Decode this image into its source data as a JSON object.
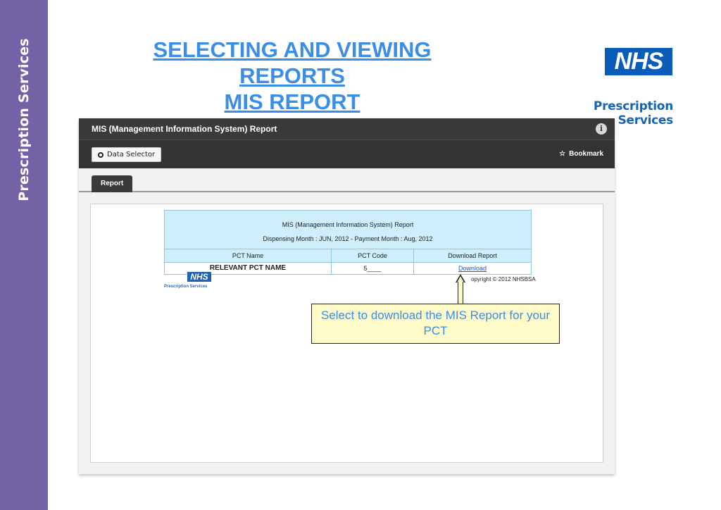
{
  "sidebar": {
    "label": "Prescription Services"
  },
  "title": {
    "line1": "SELECTING AND VIEWING REPORTS",
    "line2": "MIS REPORT"
  },
  "brand": {
    "logo": "NHS",
    "name": "Prescription Services"
  },
  "app": {
    "title": "MIS (Management Information System) Report",
    "info_icon": "i",
    "data_selector_label": "Data Selector",
    "bookmark_label": "Bookmark",
    "bookmark_icon": "☆",
    "tab_report": "Report"
  },
  "report": {
    "title": "MIS (Management Information System) Report",
    "subtitle": "Dispensing Month : JUN, 2012 - Payment Month : Aug, 2012",
    "columns": [
      "PCT Name",
      "PCT Code",
      "Download Report"
    ],
    "row": {
      "pct_name": "RELEVANT PCT NAME",
      "pct_code": "5____",
      "download": "Download"
    },
    "footer_logo": "NHS",
    "footer_brand": "Prescription Services",
    "copyright": "opyright © 2012 NHSBSA"
  },
  "callout": {
    "text": "Select to download the MIS Report for your PCT"
  },
  "colors": {
    "sidebar": "#7462a6",
    "title": "#3b8ee3",
    "nhs_blue": "#0a5cb8",
    "callout_bg": "#fffbc8"
  }
}
